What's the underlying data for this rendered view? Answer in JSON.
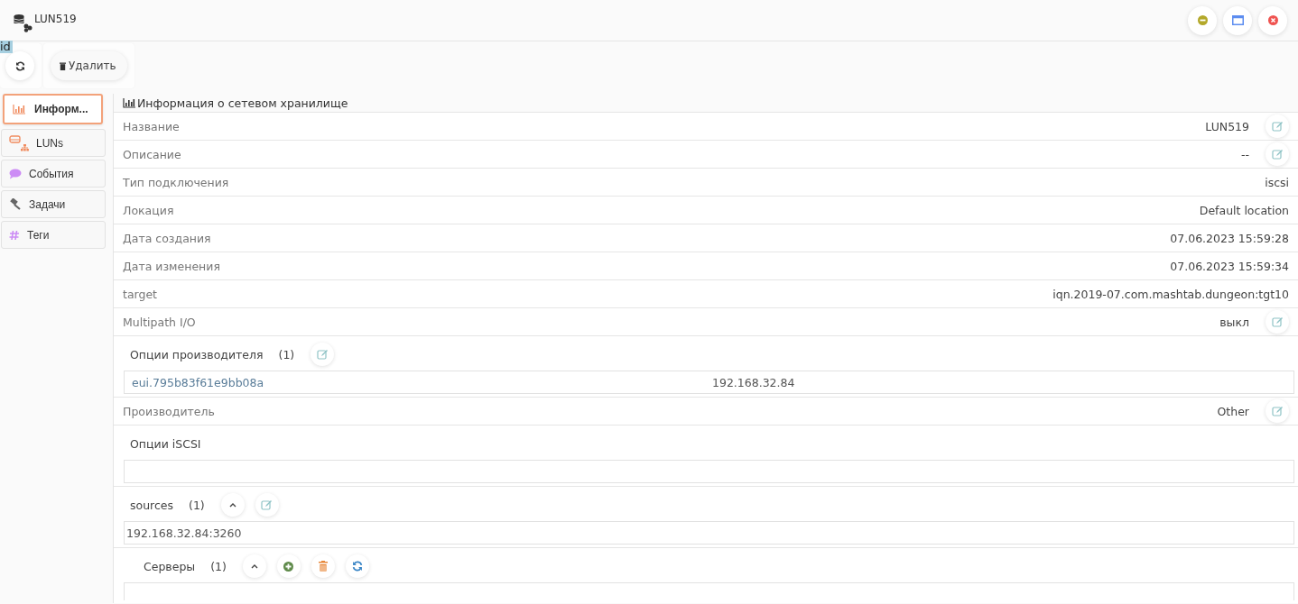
{
  "window": {
    "title": "LUN519"
  },
  "selection_text": "id",
  "toolbar": {
    "delete_label": "Удалить"
  },
  "sidebar": {
    "items": [
      {
        "label": "Информ...",
        "selected": true,
        "kind": "chart"
      },
      {
        "label": "LUNs",
        "selected": false,
        "kind": "luns"
      },
      {
        "label": "События",
        "selected": false,
        "kind": "events"
      },
      {
        "label": "Задачи",
        "selected": false,
        "kind": "tasks"
      },
      {
        "label": "Теги",
        "selected": false,
        "kind": "tags"
      }
    ]
  },
  "section_title": "Информация о сетевом хранилище",
  "properties": [
    {
      "label": "Название",
      "value": "LUN519",
      "editable": true
    },
    {
      "label": "Описание",
      "value": "--",
      "editable": true
    },
    {
      "label": "Тип подключения",
      "value": "iscsi",
      "editable": false
    },
    {
      "label": "Локация",
      "value": "Default location",
      "editable": false
    },
    {
      "label": "Дата создания",
      "value": "07.06.2023 15:59:28",
      "editable": false
    },
    {
      "label": "Дата изменения",
      "value": "07.06.2023 15:59:34",
      "editable": false
    },
    {
      "label": "target",
      "value": "iqn.2019-07.com.mashtab.dungeon:tgt10",
      "editable": false
    },
    {
      "label": "Multipath I/O",
      "value": "выкл",
      "editable": true
    }
  ],
  "vendor_options": {
    "title": "Опции производителя",
    "count": "(1)",
    "items": [
      {
        "key": "eui.795b83f61e9bb08a",
        "value": "192.168.32.84"
      }
    ]
  },
  "manufacturer": {
    "label": "Производитель",
    "value": "Other",
    "editable": true
  },
  "iscsi_options": {
    "title": "Опции iSCSI"
  },
  "sources": {
    "title": "sources",
    "count": "(1)",
    "items": [
      "192.168.32.84:3260"
    ]
  },
  "servers": {
    "title": "Серверы",
    "count": "(1)"
  }
}
